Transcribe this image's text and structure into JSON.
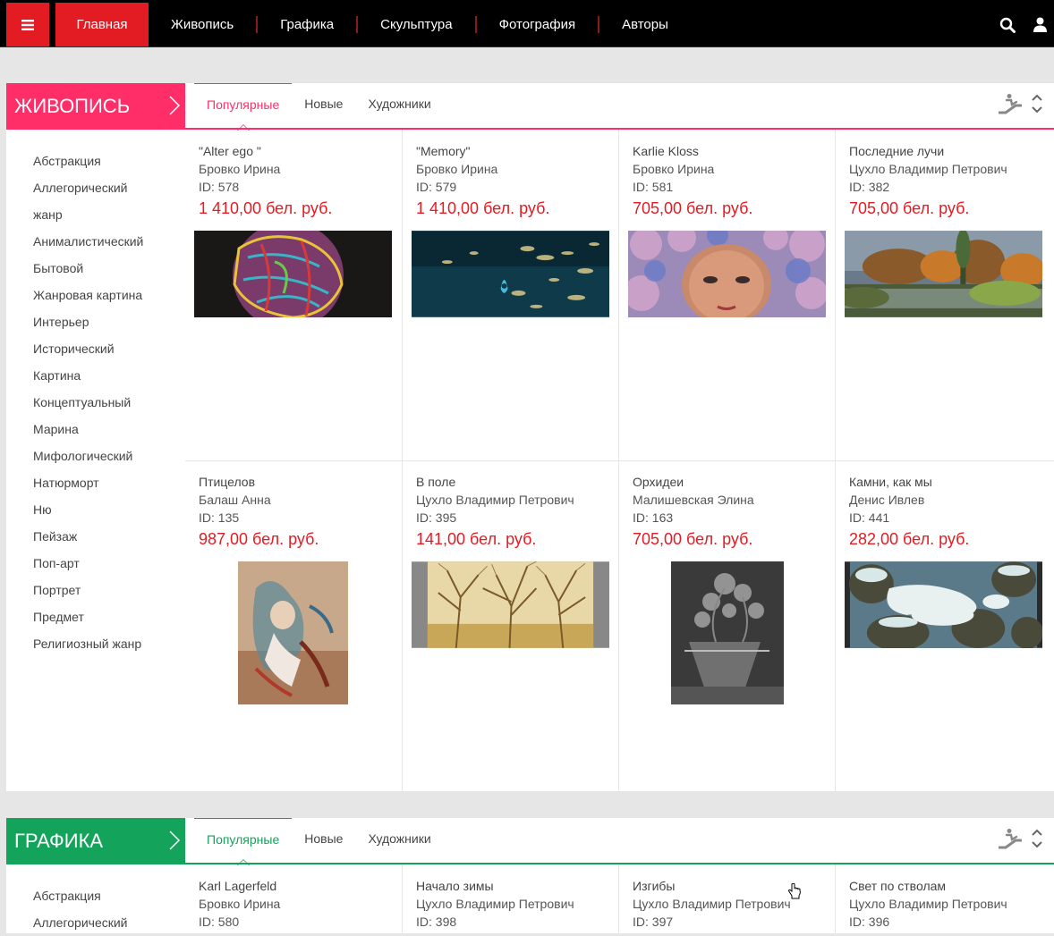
{
  "nav": {
    "menu_icon": "hamburger-icon",
    "home": "Главная",
    "items": [
      "Живопись",
      "Графика",
      "Скульптура",
      "Фотография",
      "Авторы"
    ],
    "icons": [
      "search-icon",
      "user-icon"
    ],
    "accent": "#e31b23"
  },
  "painting": {
    "title": "ЖИВОПИСЬ",
    "color": "#ff2d68",
    "tabs": [
      "Популярные",
      "Новые",
      "Художники"
    ],
    "categories": [
      "Абстракция",
      "Аллегорический",
      "жанр",
      "Анималистический",
      "Бытовой",
      "Жанровая картина",
      "Интерьер",
      "Исторический",
      "Картина",
      "Концептуальный",
      "Марина",
      "Мифологический",
      "Натюрморт",
      "Ню",
      "Пейзаж",
      "Поп-арт",
      "Портрет",
      "Предмет",
      "Религиозный жанр"
    ],
    "works": [
      {
        "title": "\"Alter ego \"",
        "author": "Бровко Ирина",
        "id": "ID: 578",
        "price": "1 410,00 бел. руб."
      },
      {
        "title": "\"Memory\"",
        "author": "Бровко Ирина",
        "id": "ID: 579",
        "price": "1 410,00 бел. руб."
      },
      {
        "title": "Karlie Kloss",
        "author": "Бровко Ирина",
        "id": "ID: 581",
        "price": "705,00 бел. руб."
      },
      {
        "title": "Последние лучи",
        "author": "Цухло Владимир Петрович",
        "id": "ID: 382",
        "price": "705,00 бел. руб."
      },
      {
        "title": "Птицелов",
        "author": "Балаш Анна",
        "id": "ID: 135",
        "price": "987,00 бел. руб."
      },
      {
        "title": "В поле",
        "author": "Цухло Владимир Петрович",
        "id": "ID: 395",
        "price": "141,00 бел. руб."
      },
      {
        "title": "Орхидеи",
        "author": "Малишевская Элина",
        "id": "ID: 163",
        "price": "705,00 бел. руб."
      },
      {
        "title": "Камни, как мы",
        "author": "Денис Ивлев",
        "id": "ID: 441",
        "price": "282,00 бел. руб."
      }
    ]
  },
  "graphics": {
    "title": "ГРАФИКА",
    "color": "#13a35a",
    "tabs": [
      "Популярные",
      "Новые",
      "Художники"
    ],
    "categories": [
      "Абстракция",
      "Аллегорический"
    ],
    "works": [
      {
        "title": "Karl Lagerfeld",
        "author": "Бровко Ирина",
        "id": "ID: 580"
      },
      {
        "title": "Начало зимы",
        "author": "Цухло Владимир Петрович",
        "id": "ID: 398"
      },
      {
        "title": "Изгибы",
        "author": "Цухло Владимир Петрович",
        "id": "ID: 397"
      },
      {
        "title": "Свет по стволам",
        "author": "Цухло Владимир Петрович",
        "id": "ID: 396"
      }
    ]
  }
}
